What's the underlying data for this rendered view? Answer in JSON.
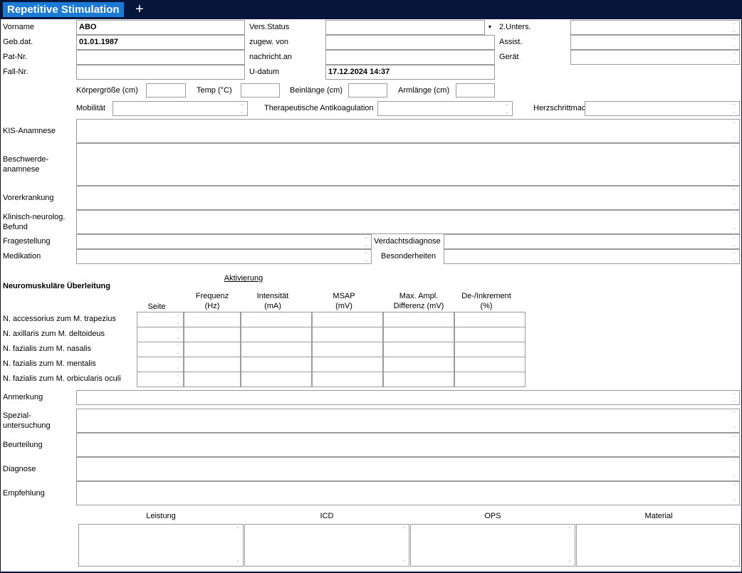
{
  "tab": {
    "title": "Repetitive Stimulation",
    "add_label": "+"
  },
  "patient": {
    "vorname_label": "Vorname",
    "vorname_value": "ABO",
    "gebdat_label": "Geb.dat.",
    "gebdat_value": "01.01.1987",
    "patnr_label": "Pat-Nr.",
    "patnr_value": "",
    "fallnr_label": "Fall-Nr.",
    "fallnr_value": "",
    "versstatus_label": "Vers.Status",
    "versstatus_value": "",
    "zugew_label": "zugew. von",
    "zugew_value": "",
    "nachricht_label": "nachricht.an",
    "nachricht_value": "",
    "udatum_label": "U-datum",
    "udatum_value": "17.12.2024 14:37",
    "unters2_label": "2.Unters.",
    "unters2_value": "",
    "assist_label": "Assist.",
    "assist_value": "",
    "geraet_label": "Gerät",
    "geraet_value": ""
  },
  "measures": {
    "koerpergroesse_label": "Körpergröße (cm)",
    "koerpergroesse_value": "",
    "temp_label": "Temp (°C)",
    "temp_value": "",
    "beinlaenge_label": "Beinlänge (cm)",
    "beinlaenge_value": "",
    "armlaenge_label": "Armlänge (cm)",
    "armlaenge_value": "",
    "mobilitaet_label": "Mobilität",
    "mobilitaet_value": "",
    "antikoag_label": "Therapeutische Antikoagulation",
    "antikoag_value": "",
    "herzschritt_label": "Herzschrittmacher",
    "herzschritt_value": ""
  },
  "history": {
    "kis_label": "KIS-Anamnese",
    "beschwerde_label_1": "Beschwerde-",
    "beschwerde_label_2": "anamnese",
    "vorerkrankung_label": "Vorerkrankung",
    "klinisch_label_1": "Klinisch-neurolog.",
    "klinisch_label_2": "Befund",
    "fragestellung_label": "Fragestellung",
    "verdacht_label": "Verdachtsdiagnose",
    "medikation_label": "Medikation",
    "besonderheiten_label": "Besonderheiten"
  },
  "nmu": {
    "section_title": "Neuromuskuläre Überleitung",
    "aktivierung_label": "Aktivierung",
    "headers": {
      "seite": "Seite",
      "frequenz_1": "Frequenz",
      "frequenz_2": "(Hz)",
      "intensitaet_1": "Intensität",
      "intensitaet_2": "(mA)",
      "msap_1": "MSAP",
      "msap_2": "(mV)",
      "maxampl_1": "Max. Ampl.",
      "maxampl_2": "Differenz (mV)",
      "deink_1": "De-/Inkrement",
      "deink_2": "(%)"
    },
    "rows": [
      "N. accessorius zum M. trapezius",
      "N. axillaris zum M. deltoideus",
      "N. fazialis zum M. nasalis",
      "N. fazialis zum M. mentalis",
      "N. fazialis zum M. orbicularis oculi"
    ]
  },
  "footer": {
    "anmerkung_label": "Anmerkung",
    "spezial_label_1": "Spezial-",
    "spezial_label_2": "untersuchung",
    "beurteilung_label": "Beurteilung",
    "diagnose_label": "Diagnose",
    "empfehlung_label": "Empfehlung",
    "leistung_label": "Leistung",
    "icd_label": "ICD",
    "ops_label": "OPS",
    "material_label": "Material"
  }
}
